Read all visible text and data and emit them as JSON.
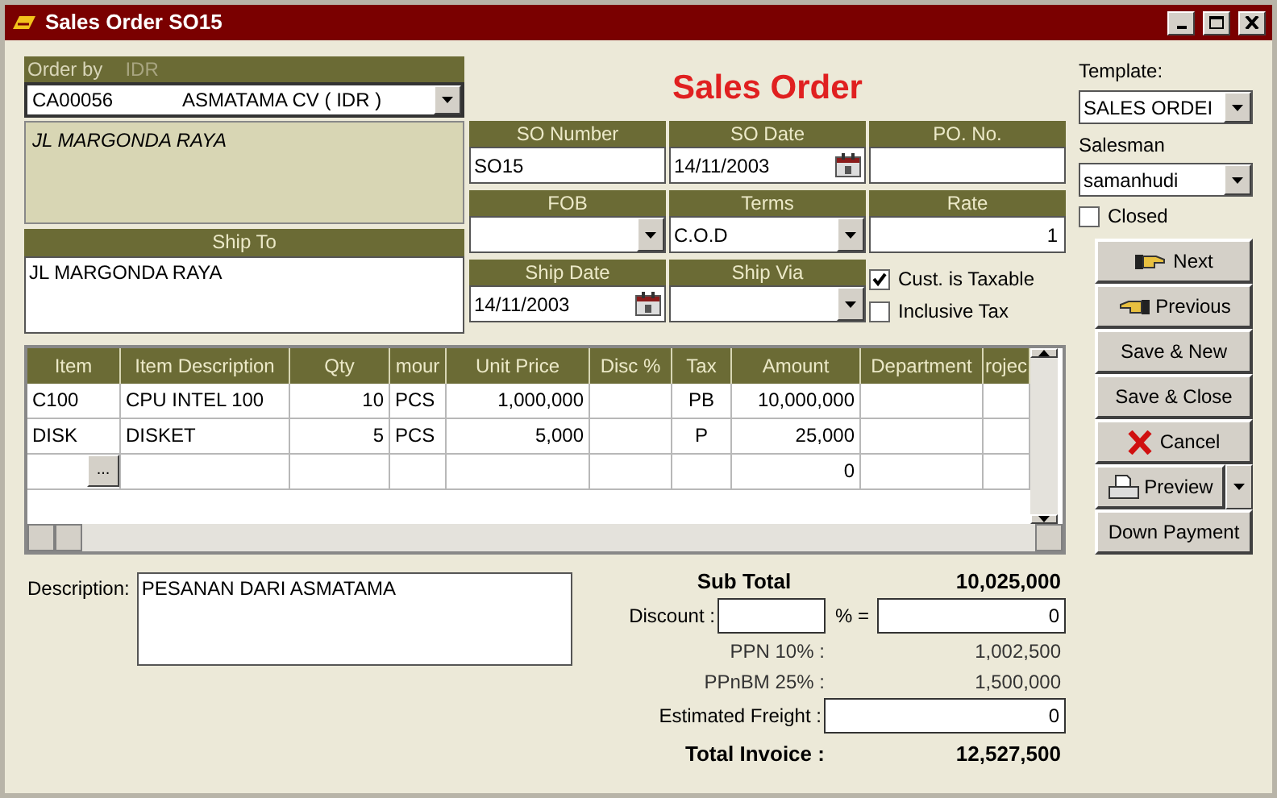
{
  "window": {
    "title": "Sales Order SO15"
  },
  "heading": "Sales Order",
  "customer": {
    "label": "Order by",
    "currency": "IDR",
    "code": "CA00056",
    "name": "ASMATAMA CV ( IDR )",
    "address": "JL MARGONDA RAYA"
  },
  "ship_to": {
    "label": "Ship To",
    "value": "JL MARGONDA RAYA"
  },
  "fields": [
    {
      "label": "SO Number",
      "value": "SO15",
      "kind": "text"
    },
    {
      "label": "SO Date",
      "value": "14/11/2003",
      "kind": "date"
    },
    {
      "label": "PO. No.",
      "kind": "text"
    },
    {
      "label": "FOB",
      "kind": "select"
    },
    {
      "label": "Terms",
      "value": "C.O.D",
      "kind": "select"
    },
    {
      "label": "Rate",
      "value": "1",
      "kind": "number"
    },
    {
      "label": "Ship Date",
      "value": "14/11/2003",
      "kind": "date"
    },
    {
      "label": "Ship Via",
      "kind": "select"
    }
  ],
  "options": [
    {
      "label": "Cust. is Taxable",
      "checked": true
    },
    {
      "label": "Inclusive Tax",
      "checked": false
    }
  ],
  "side": {
    "template_label": "Template:",
    "template": "SALES ORDEI",
    "salesman_label": "Salesman",
    "salesman": "samanhudi",
    "closed": {
      "label": "Closed",
      "checked": false
    }
  },
  "buttons": [
    {
      "label": "Next",
      "kind": "next"
    },
    {
      "label": "Previous",
      "kind": "previous"
    },
    {
      "label": "Save & New",
      "kind": "plain"
    },
    {
      "label": "Save & Close",
      "kind": "plain"
    },
    {
      "label": "Cancel",
      "kind": "cancel"
    },
    {
      "label": "Preview",
      "kind": "preview"
    },
    {
      "label": "Down Payment",
      "kind": "plain"
    }
  ],
  "table": {
    "columns": [
      "Item",
      "Item Description",
      "Qty",
      "mour",
      "Unit Price",
      "Disc %",
      "Tax",
      "Amount",
      "Department",
      "rojec"
    ],
    "rows": [
      {
        "cells": [
          "C100",
          "CPU INTEL 100",
          "10",
          "PCS",
          "1,000,000",
          null,
          "PB",
          "10,000,000",
          null,
          null
        ]
      },
      {
        "cells": [
          "DISK",
          "DISKET",
          "5",
          "PCS",
          "5,000",
          null,
          "P",
          "25,000",
          null,
          null
        ]
      },
      {
        "cells": [
          null,
          null,
          null,
          null,
          null,
          null,
          null,
          "0",
          null,
          null
        ],
        "lookup": "..."
      }
    ]
  },
  "description": {
    "label": "Description:",
    "value": "PESANAN DARI ASMATAMA"
  },
  "totals": {
    "subtotal_label": "Sub Total",
    "subtotal": "10,025,000",
    "discount_label": "Discount :",
    "discount_equals": "% =",
    "discount_amount": "0",
    "taxes": [
      {
        "label": "PPN 10% :",
        "value": "1,002,500"
      },
      {
        "label": "PPnBM 25% :",
        "value": "1,500,000"
      }
    ],
    "freight_label": "Estimated Freight :",
    "freight": "0",
    "total_label": "Total Invoice :",
    "total": "12,527,500"
  }
}
